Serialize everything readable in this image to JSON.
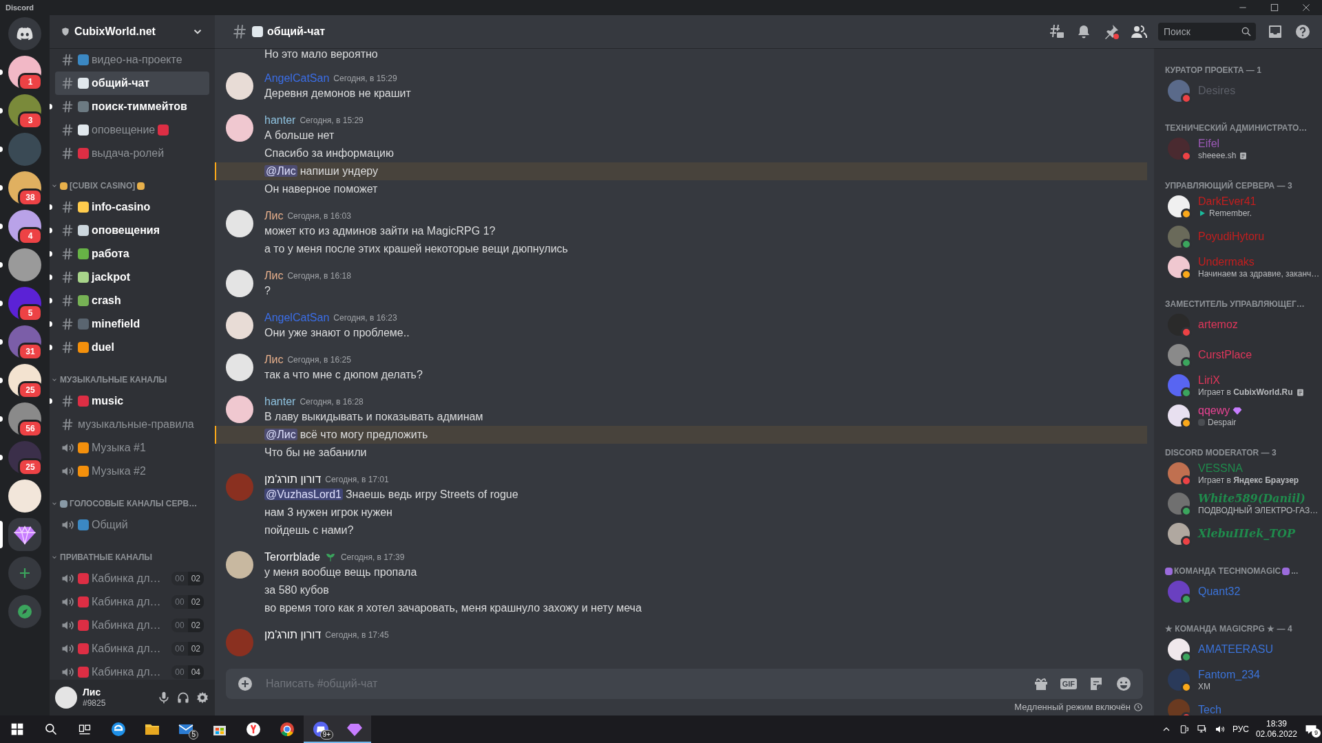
{
  "window": {
    "title": "Discord"
  },
  "servers": [
    {
      "kind": "home",
      "unread": false,
      "selected": false
    },
    {
      "kind": "server",
      "color": "#f2b8c6",
      "badge": "1",
      "unread": true,
      "selected": false
    },
    {
      "kind": "server",
      "color": "#7a8a3a",
      "badge": "3",
      "unread": true,
      "selected": false
    },
    {
      "kind": "server",
      "color": "#3a4a55",
      "unread": true,
      "selected": false
    },
    {
      "kind": "server",
      "color": "#e0b060",
      "badge": "38",
      "unread": true,
      "selected": false
    },
    {
      "kind": "server",
      "color": "#b9a2e8",
      "badge": "4",
      "unread": true,
      "selected": false
    },
    {
      "kind": "server",
      "color": "#9a9a9a",
      "unread": true,
      "selected": false
    },
    {
      "kind": "server",
      "color": "#5b22d6",
      "badge": "5",
      "unread": true,
      "selected": false
    },
    {
      "kind": "server",
      "color": "#7b5ea8",
      "badge": "31",
      "unread": true,
      "selected": false
    },
    {
      "kind": "server",
      "color": "#f3e3d0",
      "badge": "25",
      "unread": true,
      "selected": false
    },
    {
      "kind": "server",
      "color": "#8a8a8a",
      "badge": "56",
      "unread": true,
      "selected": false
    },
    {
      "kind": "server",
      "color": "#3b2f4a",
      "badge": "25",
      "unread": true,
      "selected": false
    },
    {
      "kind": "server",
      "color": "#f2e6da",
      "unread": false,
      "selected": false
    },
    {
      "kind": "gem",
      "unread": false,
      "selected": true
    },
    {
      "kind": "add",
      "unread": false,
      "selected": false
    },
    {
      "kind": "explore",
      "unread": false,
      "selected": false
    }
  ],
  "server_header": {
    "name": "CubixWorld.net"
  },
  "channels": [
    {
      "kind": "text",
      "name": "видео-на-проекте",
      "emoji": {
        "color": "#3b88c3"
      },
      "unread": false,
      "selected": false
    },
    {
      "kind": "text",
      "name": "общий-чат",
      "emoji": {
        "color": "#e1e8ed"
      },
      "unread": false,
      "selected": true
    },
    {
      "kind": "text",
      "name": "поиск-тиммейтов",
      "emoji": {
        "color": "#6c7a82"
      },
      "unread": true,
      "selected": false
    },
    {
      "kind": "text",
      "name": "оповещение",
      "emoji": {
        "color": "#e1e8ed"
      },
      "emoji_after": {
        "color": "#dd2e44"
      },
      "unread": false,
      "selected": false
    },
    {
      "kind": "text",
      "name": "выдача-ролей",
      "emoji": {
        "color": "#dd2e44"
      },
      "unread": false,
      "selected": false
    },
    {
      "kind": "category",
      "name": "[CUBIX CASINO]",
      "emoji": {
        "color": "#e8b04b"
      },
      "emoji_after": {
        "color": "#e8b04b"
      }
    },
    {
      "kind": "text",
      "name": "info-casino",
      "emoji": {
        "color": "#ffcc4d"
      },
      "unread": true,
      "selected": false
    },
    {
      "kind": "text",
      "name": "оповещения",
      "emoji": {
        "color": "#ccd6dd"
      },
      "unread": true,
      "selected": false
    },
    {
      "kind": "text",
      "name": "работа",
      "emoji": {
        "color": "#67b346"
      },
      "unread": true,
      "selected": false
    },
    {
      "kind": "text",
      "name": "jackpot",
      "emoji": {
        "color": "#a8d48a"
      },
      "unread": true,
      "selected": false
    },
    {
      "kind": "text",
      "name": "crash",
      "emoji": {
        "color": "#77b255"
      },
      "unread": true,
      "selected": false
    },
    {
      "kind": "text",
      "name": "minefield",
      "emoji": {
        "color": "#5a6570"
      },
      "unread": true,
      "selected": false
    },
    {
      "kind": "text",
      "name": "duel",
      "emoji": {
        "color": "#f4900c"
      },
      "unread": true,
      "selected": false
    },
    {
      "kind": "category",
      "name": "МУЗЫКАЛЬНЫЕ КАНАЛЫ"
    },
    {
      "kind": "text",
      "name": "music",
      "emoji": {
        "color": "#dd2e44"
      },
      "unread": true,
      "selected": false
    },
    {
      "kind": "text",
      "name": "музыкальные-правила",
      "unread": false,
      "selected": false
    },
    {
      "kind": "voice",
      "name": "Музыка #1",
      "emoji": {
        "color": "#f4900c"
      },
      "unread": false,
      "selected": false
    },
    {
      "kind": "voice",
      "name": "Музыка #2",
      "emoji": {
        "color": "#f4900c"
      },
      "unread": false,
      "selected": false
    },
    {
      "kind": "category",
      "name": "ГОЛОСОВЫЕ КАНАЛЫ СЕРВ…",
      "emoji": {
        "color": "#8899a6"
      }
    },
    {
      "kind": "voice",
      "name": "Общий",
      "emoji": {
        "color": "#3b88c3"
      },
      "unread": false,
      "selected": false
    },
    {
      "kind": "category",
      "name": "ПРИВАТНЫЕ КАНАЛЫ"
    },
    {
      "kind": "voice",
      "name": "Кабинка дл…",
      "emoji": {
        "color": "#dd2e44"
      },
      "counts": [
        "00",
        "02"
      ],
      "unread": false,
      "selected": false
    },
    {
      "kind": "voice",
      "name": "Кабинка дл…",
      "emoji": {
        "color": "#dd2e44"
      },
      "counts": [
        "00",
        "02"
      ],
      "unread": false,
      "selected": false
    },
    {
      "kind": "voice",
      "name": "Кабинка дл…",
      "emoji": {
        "color": "#dd2e44"
      },
      "counts": [
        "00",
        "02"
      ],
      "unread": false,
      "selected": false
    },
    {
      "kind": "voice",
      "name": "Кабинка дл…",
      "emoji": {
        "color": "#dd2e44"
      },
      "counts": [
        "00",
        "02"
      ],
      "unread": false,
      "selected": false
    },
    {
      "kind": "voice",
      "name": "Кабинка дл…",
      "emoji": {
        "color": "#dd2e44"
      },
      "counts": [
        "00",
        "04"
      ],
      "unread": false,
      "selected": false
    }
  ],
  "user": {
    "name": "Лис",
    "tag": "#9825"
  },
  "channel_header": {
    "name": "общий-чат",
    "emoji": {
      "color": "#e1e8ed"
    }
  },
  "search": {
    "placeholder": "Поиск"
  },
  "messages": [
    {
      "lines": [
        {
          "text": "Но это мало вероятно"
        }
      ]
    },
    {
      "author": "AngelCatSan",
      "color": "#3b6ee8",
      "avatar": {
        "color": "#e8dcd6"
      },
      "time": "Сегодня, в 15:29",
      "lines": [
        {
          "text": "Деревня демонов не крашит"
        }
      ]
    },
    {
      "author": "hanter",
      "color": "#8fc3e0",
      "avatar": {
        "color": "#f0c8d0"
      },
      "time": "Сегодня, в 15:29",
      "lines": [
        {
          "text": "А больше нет"
        },
        {
          "text": "Спасибо за информацию"
        },
        {
          "mention": "@Лис",
          "text": "напиши ундеру",
          "highlight": true
        },
        {
          "text": "Он наверное поможет"
        }
      ]
    },
    {
      "author": "Лис",
      "color": "#e8b08c",
      "avatar": {
        "color": "#e4e4e4"
      },
      "time": "Сегодня, в 16:03",
      "lines": [
        {
          "text": "может кто из админов зайти на MagicRPG 1?"
        },
        {
          "text": "а то у меня после этих крашей некоторые вещи дюпнулись"
        }
      ]
    },
    {
      "author": "Лис",
      "color": "#e8b08c",
      "avatar": {
        "color": "#e4e4e4"
      },
      "time": "Сегодня, в 16:18",
      "lines": [
        {
          "text": "?"
        }
      ]
    },
    {
      "author": "AngelCatSan",
      "color": "#3b6ee8",
      "avatar": {
        "color": "#e8dcd6"
      },
      "time": "Сегодня, в 16:23",
      "lines": [
        {
          "text": "Они уже знают о проблеме.."
        }
      ]
    },
    {
      "author": "Лис",
      "color": "#e8b08c",
      "avatar": {
        "color": "#e4e4e4"
      },
      "time": "Сегодня, в 16:25",
      "lines": [
        {
          "text": "так а что мне с дюпом делать?"
        }
      ]
    },
    {
      "author": "hanter",
      "color": "#8fc3e0",
      "avatar": {
        "color": "#f0c8d0"
      },
      "time": "Сегодня, в 16:28",
      "lines": [
        {
          "text": "В лаву выкидывать и показывать админам"
        },
        {
          "mention": "@Лис",
          "text": "всё что могу предложить",
          "highlight": true
        },
        {
          "text": "Что бы не забанили"
        }
      ]
    },
    {
      "author": "דורון תורג'מן",
      "color": "#ffffff",
      "avatar": {
        "color": "#8a3020"
      },
      "time": "Сегодня, в 17:01",
      "lines": [
        {
          "mention": "@VuzhasLord1",
          "text": "Знаешь ведь игру Streets of rogue",
          "highlight": false
        },
        {
          "text": "нам 3 нужен игрок нужен"
        },
        {
          "text": "пойдешь с нами?"
        }
      ]
    },
    {
      "author": "Terorrblade",
      "color": "#ffffff",
      "avatar": {
        "color": "#c8b8a0"
      },
      "badge": true,
      "time": "Сегодня, в 17:39",
      "lines": [
        {
          "text": "у меня вообще вещь пропала"
        },
        {
          "text": "за 580 кубов"
        },
        {
          "text": "во время того как я хотел зачаровать, меня крашнуло захожу и нету меча"
        }
      ]
    },
    {
      "author": "דורון תורג'מן",
      "color": "#ffffff",
      "avatar": {
        "color": "#8a3020"
      },
      "time": "Сегодня, в 17:45"
    }
  ],
  "composer": {
    "placeholder": "Написать #общий-чат",
    "gif": "GIF"
  },
  "slowmode": "Медленный режим включён",
  "member_groups": [
    {
      "title": "КУРАТОР ПРОЕКТА — 1",
      "members": [
        {
          "name": "Desires",
          "color": "#5c5f68",
          "avatar": {
            "color": "#5a6a8a"
          },
          "presence": {
            "color": "#ed4245"
          }
        }
      ]
    },
    {
      "title": "ТЕХНИЧЕСКИЙ АДМИНИСТРАТО…",
      "members": [
        {
          "name": "Eifel",
          "color": "#9b59b6",
          "avatar": {
            "color": "#4a2a30"
          },
          "presence": {
            "color": "#ed4245"
          },
          "activity": {
            "kind": "note",
            "text": "sheeee.sh"
          }
        }
      ]
    },
    {
      "title": "УПРАВЛЯЮЩИЙ СЕРВЕРА — 3",
      "members": [
        {
          "name": "DarkEver41",
          "color": "#c41e1e",
          "avatar": {
            "color": "#f0f0f0"
          },
          "presence": {
            "color": "#faa81a"
          },
          "activity": {
            "kind": "play",
            "text": "Remember."
          }
        },
        {
          "name": "PoyudiHytoru",
          "color": "#c41e1e",
          "avatar": {
            "color": "#6a6a5a"
          },
          "presence": {
            "color": "#3ba55d"
          }
        },
        {
          "name": "Undermaks",
          "color": "#c41e1e",
          "avatar": {
            "color": "#f0c8d0"
          },
          "presence": {
            "color": "#faa81a"
          },
          "activity": {
            "kind": "plain",
            "text": "Начинаем за здравие, заканч…"
          }
        }
      ]
    },
    {
      "title": "ЗАМЕСТИТЕЛЬ УПРАВЛЯЮЩЕГ…",
      "members": [
        {
          "name": "artemoz",
          "color": "#e0365a",
          "avatar": {
            "color": "#2a2a2a"
          },
          "presence": {
            "color": "#ed4245"
          }
        },
        {
          "name": "CurstPlace",
          "color": "#e0365a",
          "avatar": {
            "color": "#8a8a8a"
          },
          "presence": {
            "color": "#3ba55d"
          }
        },
        {
          "name": "LiriX",
          "color": "#e0365a",
          "avatar": {
            "color": "#5865f2"
          },
          "presence": {
            "color": "#3ba55d"
          },
          "activity": {
            "kind": "note",
            "text": "Играет в **CubixWorld.Ru**"
          }
        },
        {
          "name": "qqewy",
          "color": "#e84393",
          "avatar": {
            "color": "#e8e0f0"
          },
          "presence": {
            "color": "#faa81a"
          },
          "boost": true,
          "activity": {
            "kind": "emoji",
            "text": "Despair"
          }
        }
      ]
    },
    {
      "title": "DISCORD MODERATOR — 3",
      "members": [
        {
          "name": "VESSNA",
          "kind": "plain",
          "color": "#1f8b4c",
          "avatar": {
            "color": "#c07050"
          },
          "presence": {
            "color": "#ed4245"
          },
          "activity": {
            "kind": "plain",
            "text": "Играет в **Яндекс Браузер**"
          }
        },
        {
          "name": "White589(Daniil)",
          "kind": "script",
          "color": "#1f8b4c",
          "avatar": {
            "color": "#707070"
          },
          "presence": {
            "color": "#3ba55d"
          },
          "activity": {
            "kind": "plain",
            "text": "ПОДВОДНЫЙ ЭЛЕКТРО-ГАЗ…"
          }
        },
        {
          "name": "XlebuIIIek_TOP",
          "kind": "script",
          "color": "#1f8b4c",
          "avatar": {
            "color": "#b0a8a0"
          },
          "presence": {
            "color": "#ed4245"
          }
        }
      ]
    },
    {
      "title": "КОМАНДА **TECHNOMAGIC**",
      "emoji": {
        "color": "#9b6bdc"
      },
      "tail": "...",
      "members": [
        {
          "name": "Quant32",
          "color": "#3b73d9",
          "avatar": {
            "color": "#6a40c0"
          },
          "presence": {
            "color": "#3ba55d"
          }
        }
      ]
    },
    {
      "title": "★ КОМАНДА **MAGICRPG** ★ — 4",
      "members": [
        {
          "name": "AMATEERASU",
          "color": "#3b73d9",
          "avatar": {
            "color": "#f0e8ec"
          },
          "presence": {
            "color": "#3ba55d"
          }
        },
        {
          "name": "Fantom_234",
          "color": "#3b73d9",
          "avatar": {
            "color": "#2a3a5a"
          },
          "presence": {
            "color": "#faa81a"
          },
          "activity": {
            "kind": "plain",
            "text": "XM"
          }
        },
        {
          "name": "Tech",
          "color": "#3b73d9",
          "avatar": {
            "color": "#6a3a20"
          },
          "presence": {
            "color": "#ed4245"
          }
        }
      ]
    }
  ],
  "taskbar": {
    "apps": [
      {
        "kind": "edge",
        "active": false
      },
      {
        "kind": "folder",
        "active": false
      },
      {
        "kind": "mail",
        "badge": "5",
        "active": false
      },
      {
        "kind": "store",
        "active": false
      },
      {
        "kind": "yandex",
        "active": false
      },
      {
        "kind": "chrome",
        "active": false
      },
      {
        "kind": "discord",
        "badge": "9+",
        "active": true
      },
      {
        "kind": "gem",
        "active": true
      }
    ],
    "lang": "РУС",
    "time": "18:39",
    "date": "02.06.2022",
    "notifications": "9"
  }
}
